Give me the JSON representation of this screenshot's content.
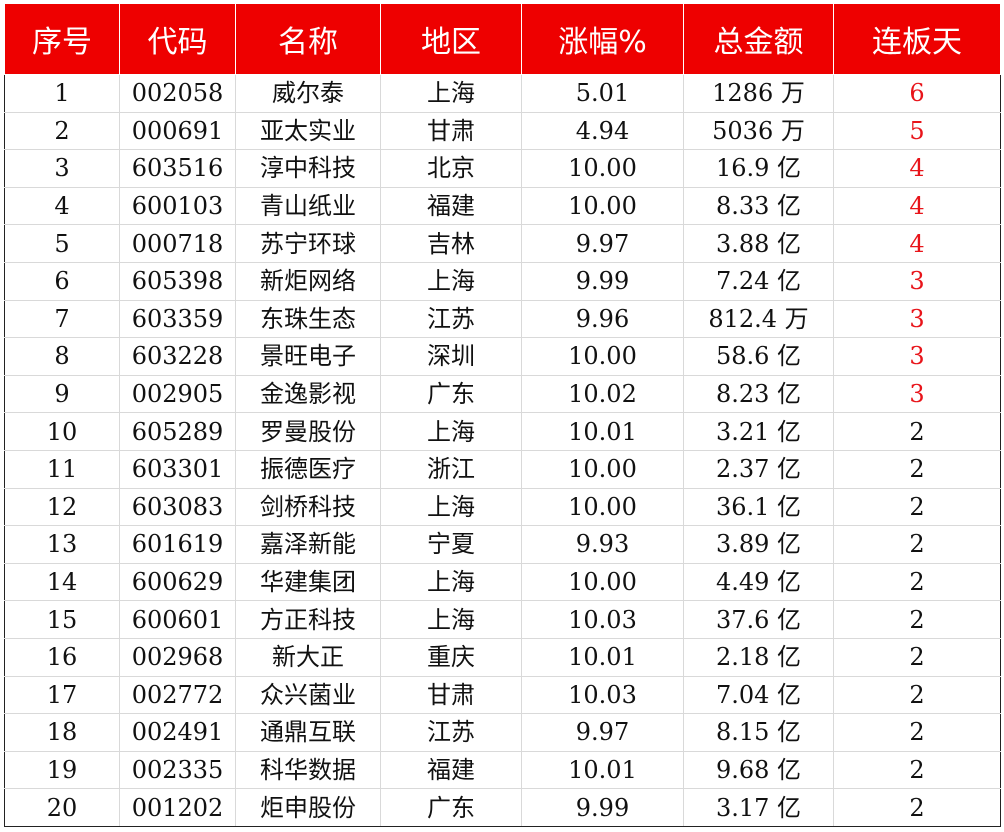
{
  "table": {
    "headers": [
      "序号",
      "代码",
      "名称",
      "地区",
      "涨幅%",
      "总金额",
      "连板天"
    ],
    "rows": [
      [
        "1",
        "002058",
        "威尔泰",
        "上海",
        "5.01",
        "1286 万",
        "6"
      ],
      [
        "2",
        "000691",
        "亚太实业",
        "甘肃",
        "4.94",
        "5036 万",
        "5"
      ],
      [
        "3",
        "603516",
        "淳中科技",
        "北京",
        "10.00",
        "16.9 亿",
        "4"
      ],
      [
        "4",
        "600103",
        "青山纸业",
        "福建",
        "10.00",
        "8.33 亿",
        "4"
      ],
      [
        "5",
        "000718",
        "苏宁环球",
        "吉林",
        "9.97",
        "3.88 亿",
        "4"
      ],
      [
        "6",
        "605398",
        "新炬网络",
        "上海",
        "9.99",
        "7.24 亿",
        "3"
      ],
      [
        "7",
        "603359",
        "东珠生态",
        "江苏",
        "9.96",
        "812.4 万",
        "3"
      ],
      [
        "8",
        "603228",
        "景旺电子",
        "深圳",
        "10.00",
        "58.6 亿",
        "3"
      ],
      [
        "9",
        "002905",
        "金逸影视",
        "广东",
        "10.02",
        "8.23 亿",
        "3"
      ],
      [
        "10",
        "605289",
        "罗曼股份",
        "上海",
        "10.01",
        "3.21 亿",
        "2"
      ],
      [
        "11",
        "603301",
        "振德医疗",
        "浙江",
        "10.00",
        "2.37 亿",
        "2"
      ],
      [
        "12",
        "603083",
        "剑桥科技",
        "上海",
        "10.00",
        "36.1 亿",
        "2"
      ],
      [
        "13",
        "601619",
        "嘉泽新能",
        "宁夏",
        "9.93",
        "3.89 亿",
        "2"
      ],
      [
        "14",
        "600629",
        "华建集团",
        "上海",
        "10.00",
        "4.49 亿",
        "2"
      ],
      [
        "15",
        "600601",
        "方正科技",
        "上海",
        "10.03",
        "37.6 亿",
        "2"
      ],
      [
        "16",
        "002968",
        "新大正",
        "重庆",
        "10.01",
        "2.18 亿",
        "2"
      ],
      [
        "17",
        "002772",
        "众兴菌业",
        "甘肃",
        "10.03",
        "7.04 亿",
        "2"
      ],
      [
        "18",
        "002491",
        "通鼎互联",
        "江苏",
        "9.97",
        "8.15 亿",
        "2"
      ],
      [
        "19",
        "002335",
        "科华数据",
        "福建",
        "10.01",
        "9.68 亿",
        "2"
      ],
      [
        "20",
        "001202",
        "炬申股份",
        "广东",
        "9.99",
        "3.17 亿",
        "2"
      ]
    ],
    "red_days_rows": 9
  },
  "colors": {
    "header_bg": "#ee0000",
    "header_text": "#ffffff",
    "highlight_text": "#e8141a",
    "grid": "#d9d9d9"
  }
}
